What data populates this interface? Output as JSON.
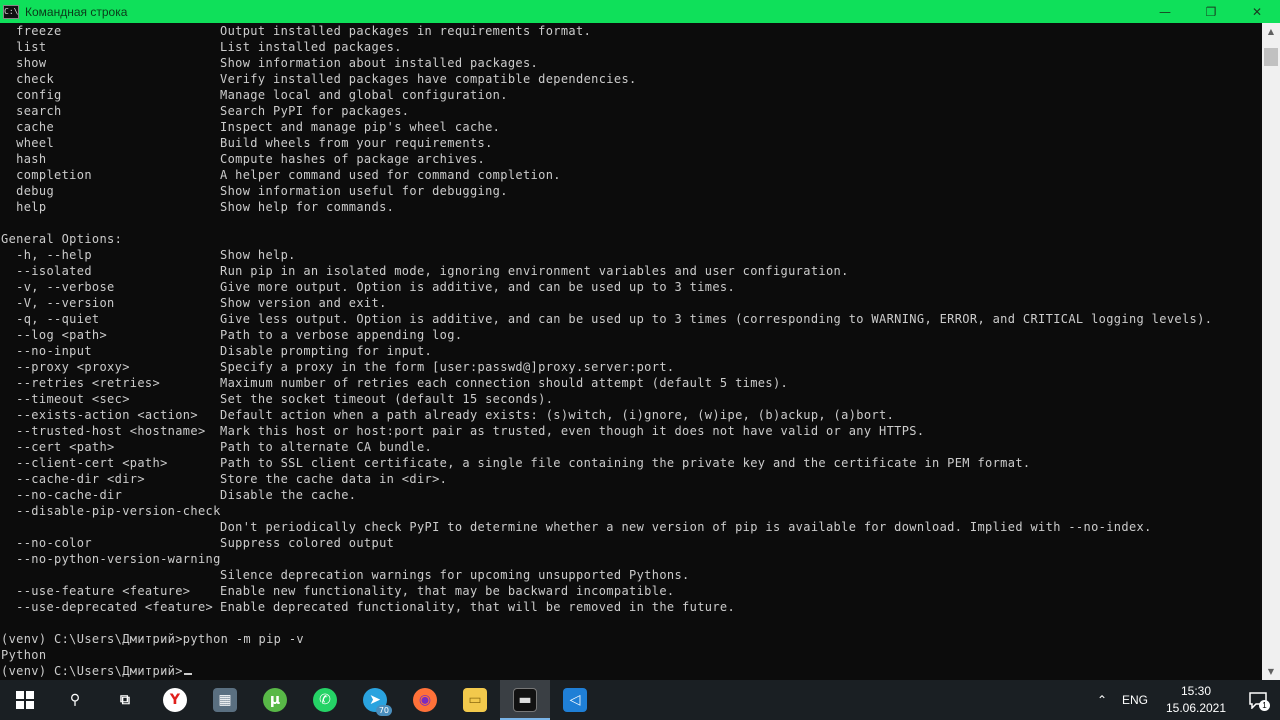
{
  "window": {
    "title": "Командная строка",
    "icon_text": "C:\\",
    "controls": {
      "minimize": "—",
      "maximize": "❐",
      "close": "✕"
    }
  },
  "console": {
    "commands": [
      {
        "cmd": "  freeze",
        "desc": "Output installed packages in requirements format."
      },
      {
        "cmd": "  list",
        "desc": "List installed packages."
      },
      {
        "cmd": "  show",
        "desc": "Show information about installed packages."
      },
      {
        "cmd": "  check",
        "desc": "Verify installed packages have compatible dependencies."
      },
      {
        "cmd": "  config",
        "desc": "Manage local and global configuration."
      },
      {
        "cmd": "  search",
        "desc": "Search PyPI for packages."
      },
      {
        "cmd": "  cache",
        "desc": "Inspect and manage pip's wheel cache."
      },
      {
        "cmd": "  wheel",
        "desc": "Build wheels from your requirements."
      },
      {
        "cmd": "  hash",
        "desc": "Compute hashes of package archives."
      },
      {
        "cmd": "  completion",
        "desc": "A helper command used for command completion."
      },
      {
        "cmd": "  debug",
        "desc": "Show information useful for debugging."
      },
      {
        "cmd": "  help",
        "desc": "Show help for commands."
      }
    ],
    "general_options_header": "General Options:",
    "options": [
      {
        "cmd": "  -h, --help",
        "desc": "Show help."
      },
      {
        "cmd": "  --isolated",
        "desc": "Run pip in an isolated mode, ignoring environment variables and user configuration."
      },
      {
        "cmd": "  -v, --verbose",
        "desc": "Give more output. Option is additive, and can be used up to 3 times."
      },
      {
        "cmd": "  -V, --version",
        "desc": "Show version and exit."
      },
      {
        "cmd": "  -q, --quiet",
        "desc": "Give less output. Option is additive, and can be used up to 3 times (corresponding to WARNING, ERROR, and CRITICAL logging levels)."
      },
      {
        "cmd": "  --log <path>",
        "desc": "Path to a verbose appending log."
      },
      {
        "cmd": "  --no-input",
        "desc": "Disable prompting for input."
      },
      {
        "cmd": "  --proxy <proxy>",
        "desc": "Specify a proxy in the form [user:passwd@]proxy.server:port."
      },
      {
        "cmd": "  --retries <retries>",
        "desc": "Maximum number of retries each connection should attempt (default 5 times)."
      },
      {
        "cmd": "  --timeout <sec>",
        "desc": "Set the socket timeout (default 15 seconds)."
      },
      {
        "cmd": "  --exists-action <action>",
        "desc": "Default action when a path already exists: (s)witch, (i)gnore, (w)ipe, (b)ackup, (a)bort."
      },
      {
        "cmd": "  --trusted-host <hostname>",
        "desc": "Mark this host or host:port pair as trusted, even though it does not have valid or any HTTPS."
      },
      {
        "cmd": "  --cert <path>",
        "desc": "Path to alternate CA bundle."
      },
      {
        "cmd": "  --client-cert <path>",
        "desc": "Path to SSL client certificate, a single file containing the private key and the certificate in PEM format."
      },
      {
        "cmd": "  --cache-dir <dir>",
        "desc": "Store the cache data in <dir>."
      },
      {
        "cmd": "  --no-cache-dir",
        "desc": "Disable the cache."
      },
      {
        "cmd": "  --disable-pip-version-check",
        "desc": ""
      },
      {
        "cmd": "",
        "desc": "Don't periodically check PyPI to determine whether a new version of pip is available for download. Implied with --no-index."
      },
      {
        "cmd": "  --no-color",
        "desc": "Suppress colored output"
      },
      {
        "cmd": "  --no-python-version-warning",
        "desc": ""
      },
      {
        "cmd": "",
        "desc": "Silence deprecation warnings for upcoming unsupported Pythons."
      },
      {
        "cmd": "  --use-feature <feature>",
        "desc": "Enable new functionality, that may be backward incompatible."
      },
      {
        "cmd": "  --use-deprecated <feature>",
        "desc": "Enable deprecated functionality, that will be removed in the future."
      }
    ],
    "prompt_line_1": "(venv) C:\\Users\\Дмитрий>python -m pip -v",
    "output_line": "Python",
    "prompt_line_2": "(venv) C:\\Users\\Дмитрий>"
  },
  "taskbar": {
    "apps": [
      {
        "name": "search-icon",
        "glyph": "⚲",
        "color": "transparent",
        "fg": "#ffffff"
      },
      {
        "name": "task-view-icon",
        "glyph": "⧉",
        "color": "transparent",
        "fg": "#ffffff"
      },
      {
        "name": "yandex-browser-icon",
        "glyph": "Y",
        "color": "#ffffff",
        "fg": "#e0201c"
      },
      {
        "name": "calculator-icon",
        "glyph": "▦",
        "color": "#5a6f80",
        "fg": "#ffffff"
      },
      {
        "name": "utorrent-icon",
        "glyph": "µ",
        "color": "#58b847",
        "fg": "#ffffff"
      },
      {
        "name": "whatsapp-icon",
        "glyph": "✆",
        "color": "#25d366",
        "fg": "#ffffff"
      },
      {
        "name": "telegram-icon",
        "glyph": "➤",
        "color": "#2aa3df",
        "fg": "#ffffff"
      },
      {
        "name": "firefox-icon",
        "glyph": "◉",
        "color": "#ff7139",
        "fg": "#7a2cbf"
      },
      {
        "name": "file-explorer-icon",
        "glyph": "▭",
        "color": "#f2c94c",
        "fg": "#8a6a10"
      },
      {
        "name": "command-prompt-icon",
        "glyph": "▬",
        "color": "#111111",
        "fg": "#dddddd"
      },
      {
        "name": "vscode-icon",
        "glyph": "◁",
        "color": "#1f7fd6",
        "fg": "#ffffff"
      }
    ],
    "telegram_badge": "70",
    "tray_chevron": "⌃",
    "language": "ENG",
    "time": "15:30",
    "date": "15.06.2021",
    "notification_count": "1"
  }
}
